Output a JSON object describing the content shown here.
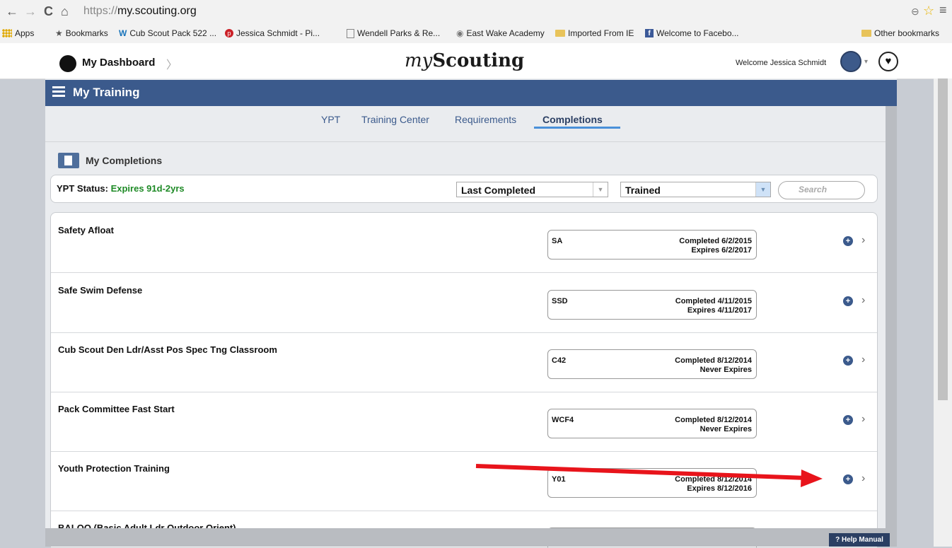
{
  "browser": {
    "url_scheme": "https://",
    "url_host": "my.scouting.org",
    "nav": {
      "back": "←",
      "forward": "→",
      "reload": "C",
      "home": "⌂"
    },
    "bookmarks": [
      {
        "label": "Apps",
        "icon": "apps-grid-icon",
        "color": "#e0a800"
      },
      {
        "label": "Bookmarks",
        "icon": "star-icon",
        "color": "#555"
      },
      {
        "label": "Cub Scout Pack 522 ...",
        "icon": "w-logo-icon",
        "color": "#1a75bb"
      },
      {
        "label": "Jessica Schmidt - Pi...",
        "icon": "pinterest-icon",
        "color": "#cb2027"
      },
      {
        "label": "Wendell Parks & Re...",
        "icon": "page-icon",
        "color": "#888"
      },
      {
        "label": "East Wake Academy",
        "icon": "globe-icon",
        "color": "#777"
      },
      {
        "label": "Imported From IE",
        "icon": "folder-icon",
        "color": "#e8c35a"
      },
      {
        "label": "Welcome to Facebo...",
        "icon": "facebook-icon",
        "color": "#3b5998"
      }
    ],
    "other_bookmarks": "Other bookmarks"
  },
  "header": {
    "dashboard_label": "My Dashboard",
    "brand_my": "my",
    "brand_name": "Scouting",
    "welcome": "Welcome Jessica Schmidt"
  },
  "training": {
    "title": "My Training",
    "tabs": [
      {
        "label": "YPT",
        "active": false
      },
      {
        "label": "Training Center",
        "active": false
      },
      {
        "label": "Requirements",
        "active": false
      },
      {
        "label": "Completions",
        "active": true
      }
    ],
    "section_title": "My Completions",
    "ypt_status_label": "YPT Status:",
    "ypt_status_value": "Expires 91d-2yrs",
    "sort_value": "Last Completed",
    "filter_value": "Trained",
    "search_placeholder": "Search",
    "completions": [
      {
        "title": "Safety Afloat",
        "code": "SA",
        "completed": "Completed 6/2/2015",
        "expires": "Expires 6/2/2017"
      },
      {
        "title": "Safe Swim Defense",
        "code": "SSD",
        "completed": "Completed 4/11/2015",
        "expires": "Expires 4/11/2017"
      },
      {
        "title": "Cub Scout Den Ldr/Asst Pos Spec Tng Classroom",
        "code": "C42",
        "completed": "Completed 8/12/2014",
        "expires": "Never Expires"
      },
      {
        "title": "Pack Committee Fast Start",
        "code": "WCF4",
        "completed": "Completed 8/12/2014",
        "expires": "Never Expires"
      },
      {
        "title": "Youth Protection Training",
        "code": "Y01",
        "completed": "Completed 8/12/2014",
        "expires": "Expires 8/12/2016"
      },
      {
        "title": "BALOO (Basic Adult Ldr Outdoor Orient)",
        "code": "",
        "completed": "",
        "expires": ""
      }
    ],
    "help_label": "Help Manual"
  },
  "colors": {
    "title_bar": "#3b5a8c",
    "status_green": "#1e8a26",
    "annotation_arrow": "#e8141b"
  }
}
